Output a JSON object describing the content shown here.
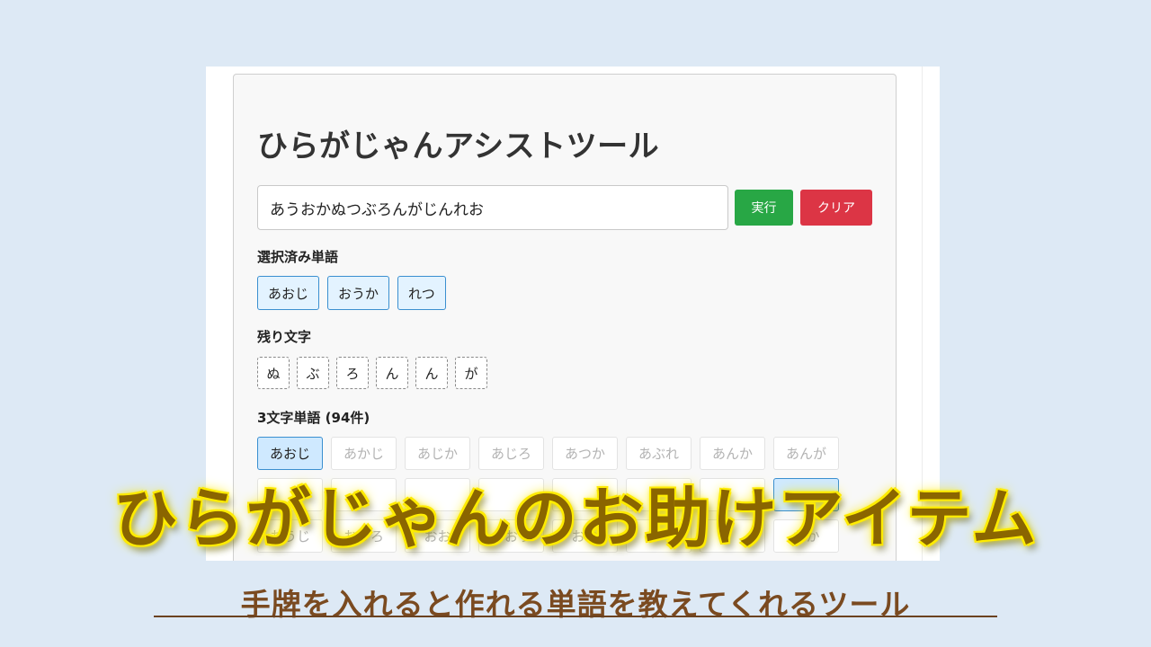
{
  "app": {
    "title": "ひらがじゃんアシストツール"
  },
  "search": {
    "value": "あうおかぬつぶろんがじんれお"
  },
  "buttons": {
    "run_label": "実行",
    "clear_label": "クリア"
  },
  "selected_words": {
    "label": "選択済み単語",
    "items": [
      "あおじ",
      "おうか",
      "れつ"
    ]
  },
  "remaining_chars": {
    "label": "残り文字",
    "items": [
      "ぬ",
      "ぶ",
      "ろ",
      "ん",
      "ん",
      "が"
    ]
  },
  "three_char_words": {
    "label": "3文字単語 (94件)",
    "items": [
      "あおじ",
      "あかじ",
      "あじか",
      "あじろ",
      "あつか",
      "あぶれ",
      "あんか",
      "あんが"
    ],
    "active_index": 0,
    "row3_items": [
      "おうじ",
      "おうろ",
      "おお",
      "おおう",
      "おお",
      "",
      "",
      "おか"
    ]
  },
  "overlay": {
    "title": "ひらがじゃんのお助けアイテム",
    "subtitle": "手牌を入れると作れる単語を教えてくれるツール"
  },
  "colors": {
    "background": "#dde9f5",
    "run_button": "#28a745",
    "clear_button": "#dc3545",
    "selected_border": "#3a8fd0",
    "overlay_title": "#8a6500",
    "overlay_glow": "#ffe600",
    "subtitle": "#7a4a20"
  }
}
